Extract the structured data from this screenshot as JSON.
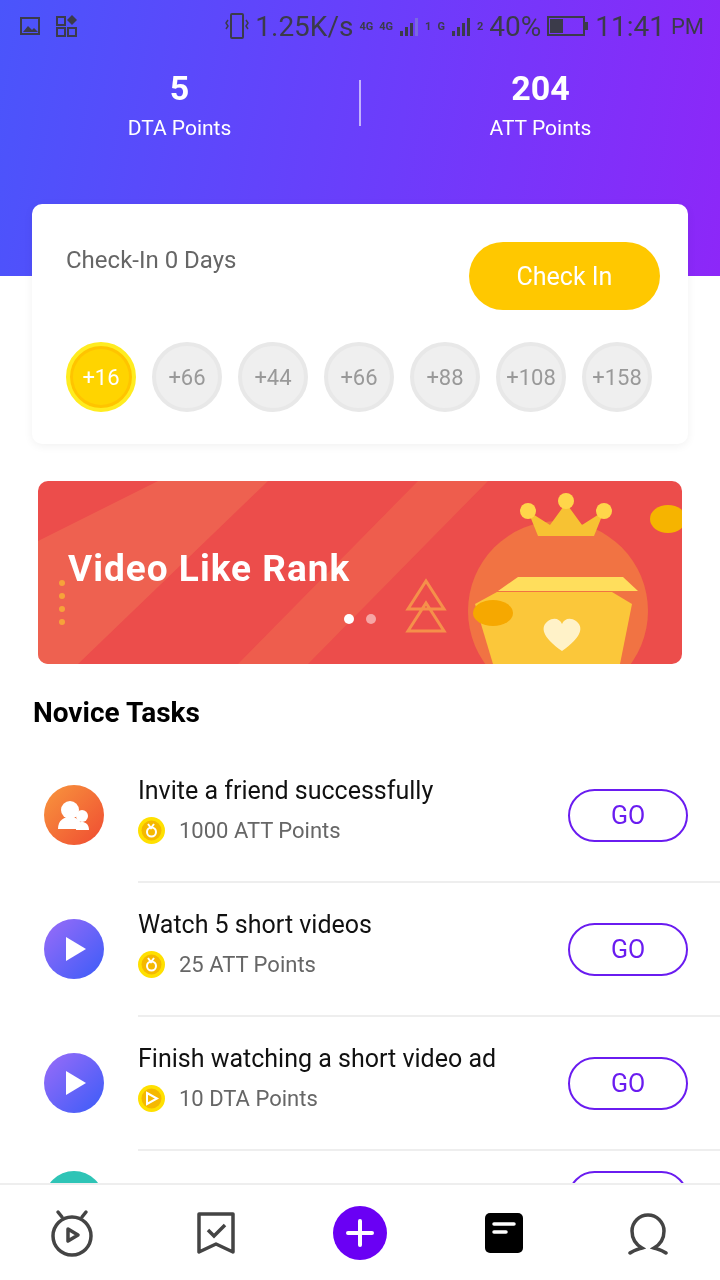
{
  "status_bar": {
    "speed": "1.25K/s",
    "sim1_type": "4G",
    "sim1_type2": "4G",
    "sim1_slot": "1",
    "sim2_type": "G",
    "sim2_slot": "2",
    "battery": "40%",
    "time": "11:41",
    "ampm": "PM"
  },
  "stats": [
    {
      "value": "5",
      "label": "DTA Points"
    },
    {
      "value": "204",
      "label": "ATT Points"
    }
  ],
  "checkin": {
    "title": "Check-In 0 Days",
    "button": "Check In",
    "days": [
      {
        "reward": "+16",
        "checked": true
      },
      {
        "reward": "+66",
        "checked": false
      },
      {
        "reward": "+44",
        "checked": false
      },
      {
        "reward": "+66",
        "checked": false
      },
      {
        "reward": "+88",
        "checked": false
      },
      {
        "reward": "+108",
        "checked": false
      },
      {
        "reward": "+158",
        "checked": false
      }
    ]
  },
  "banner": {
    "title": "Video Like Rank",
    "slides": [
      {
        "selected": true
      },
      {
        "selected": false
      }
    ]
  },
  "novice_tasks": {
    "heading": "Novice Tasks",
    "tasks": [
      {
        "kind": "invite",
        "title": "Invite a friend successfully",
        "reward": {
          "kind": "att",
          "text": "1000 ATT Points"
        },
        "button": "GO"
      },
      {
        "kind": "video",
        "title": "Watch 5 short videos",
        "reward": {
          "kind": "att",
          "text": "25 ATT Points"
        },
        "button": "GO"
      },
      {
        "kind": "video",
        "title": "Finish watching a short video ad",
        "reward": {
          "kind": "dta",
          "text": "10 DTA Points"
        },
        "button": "GO"
      },
      {
        "kind": "rate"
      }
    ]
  },
  "bottom_nav": [
    {
      "kind": "home",
      "selected": false
    },
    {
      "kind": "tasks",
      "selected": false
    },
    {
      "kind": "add",
      "selected": false
    },
    {
      "kind": "feed",
      "selected": true
    },
    {
      "kind": "profile",
      "selected": false
    }
  ]
}
